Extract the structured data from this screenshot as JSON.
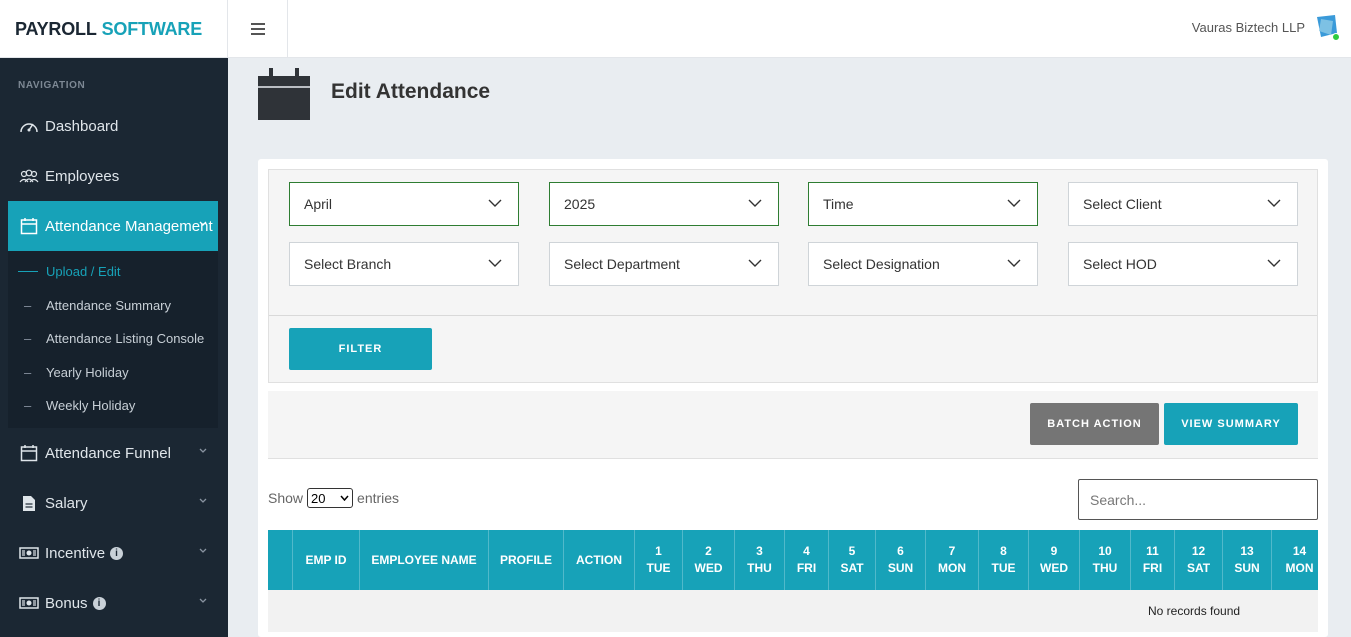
{
  "brand": {
    "part1": "PAYROLL",
    "part2": "SOFTWARE"
  },
  "header": {
    "company": "Vauras Biztech LLP"
  },
  "sidebar": {
    "heading": "NAVIGATION",
    "items": [
      {
        "label": "Dashboard",
        "icon": "dashboard-icon"
      },
      {
        "label": "Employees",
        "icon": "employees-icon"
      },
      {
        "label": "Attendance Management",
        "icon": "calendar-icon"
      },
      {
        "label": "Attendance Funnel",
        "icon": "calendar-icon"
      },
      {
        "label": "Salary",
        "icon": "document-icon"
      },
      {
        "label": "Incentive",
        "icon": "money-icon"
      },
      {
        "label": "Bonus",
        "icon": "money-icon"
      }
    ],
    "submenu": [
      "Upload / Edit",
      "Attendance Summary",
      "Attendance Listing Console",
      "Yearly Holiday",
      "Weekly Holiday"
    ]
  },
  "page": {
    "title": "Edit Attendance"
  },
  "filters": {
    "month": "April",
    "year": "2025",
    "time": "Time",
    "client": "Select Client",
    "branch": "Select Branch",
    "department": "Select Department",
    "designation": "Select Designation",
    "hod": "Select HOD",
    "filter_button": "FILTER"
  },
  "actions": {
    "batch": "BATCH ACTION",
    "summary": "VIEW SUMMARY"
  },
  "table": {
    "show": "Show",
    "entries_value": "20",
    "entries": "entries",
    "search_placeholder": "Search...",
    "headers": [
      "EMP ID",
      "EMPLOYEE NAME",
      "PROFILE",
      "ACTION"
    ],
    "days": [
      {
        "d": "1",
        "w": "TUE"
      },
      {
        "d": "2",
        "w": "WED"
      },
      {
        "d": "3",
        "w": "THU"
      },
      {
        "d": "4",
        "w": "FRI"
      },
      {
        "d": "5",
        "w": "SAT"
      },
      {
        "d": "6",
        "w": "SUN"
      },
      {
        "d": "7",
        "w": "MON"
      },
      {
        "d": "8",
        "w": "TUE"
      },
      {
        "d": "9",
        "w": "WED"
      },
      {
        "d": "10",
        "w": "THU"
      },
      {
        "d": "11",
        "w": "FRI"
      },
      {
        "d": "12",
        "w": "SAT"
      },
      {
        "d": "13",
        "w": "SUN"
      },
      {
        "d": "14",
        "w": "MON"
      }
    ],
    "empty": "No records found"
  },
  "colors": {
    "accent": "#17a2b8",
    "sidebar": "#1b2733",
    "gray_button": "#757575"
  }
}
